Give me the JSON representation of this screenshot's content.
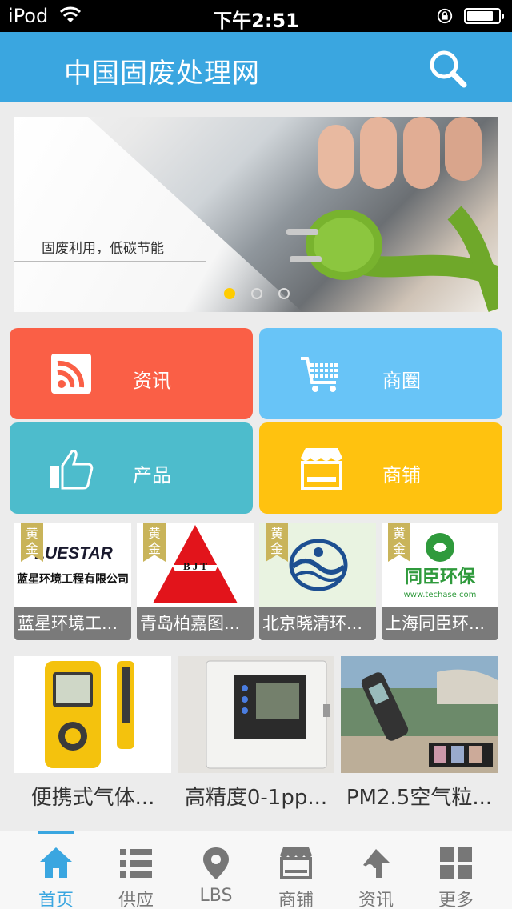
{
  "status_bar": {
    "carrier": "iPod",
    "time": "下午2:51"
  },
  "header": {
    "title": "中国固废处理网",
    "search_icon": "search-icon"
  },
  "banner": {
    "caption": "固废利用，低碳节能",
    "slide_count": 3,
    "active_slide": 1
  },
  "tiles": [
    {
      "label": "资讯",
      "icon": "rss-icon",
      "color": "#fa5f46"
    },
    {
      "label": "商圈",
      "icon": "shopping-cart-icon",
      "color": "#68c4f7"
    },
    {
      "label": "产品",
      "icon": "thumbs-up-icon",
      "color": "#4dbccc"
    },
    {
      "label": "商铺",
      "icon": "storefront-icon",
      "color": "#ffc20f"
    }
  ],
  "partners": [
    {
      "badge": "黄金",
      "logo_text": "LUESTAR",
      "logo_subtext": "蓝星环境工程有限公司",
      "name": "蓝星环境工..."
    },
    {
      "badge": "黄金",
      "logo_text": "B J T",
      "name": "青岛柏嘉图..."
    },
    {
      "badge": "黄金",
      "name": "北京晓清环..."
    },
    {
      "badge": "黄金",
      "logo_text": "同臣环保",
      "logo_subtext": "www.techase.com",
      "name": "上海同臣环..."
    }
  ],
  "products": [
    {
      "name": "便携式气体..."
    },
    {
      "name": "高精度0-1pp..."
    },
    {
      "name": "PM2.5空气粒..."
    }
  ],
  "tabbar": {
    "items": [
      {
        "label": "首页",
        "icon": "home-icon",
        "active": true
      },
      {
        "label": "供应",
        "icon": "list-icon",
        "active": false
      },
      {
        "label": "LBS",
        "icon": "location-pin-icon",
        "active": false
      },
      {
        "label": "商铺",
        "icon": "storefront-icon",
        "active": false
      },
      {
        "label": "资讯",
        "icon": "news-icon",
        "active": false
      },
      {
        "label": "更多",
        "icon": "grid-icon",
        "active": false
      }
    ],
    "accent": "#3aa6e0"
  }
}
